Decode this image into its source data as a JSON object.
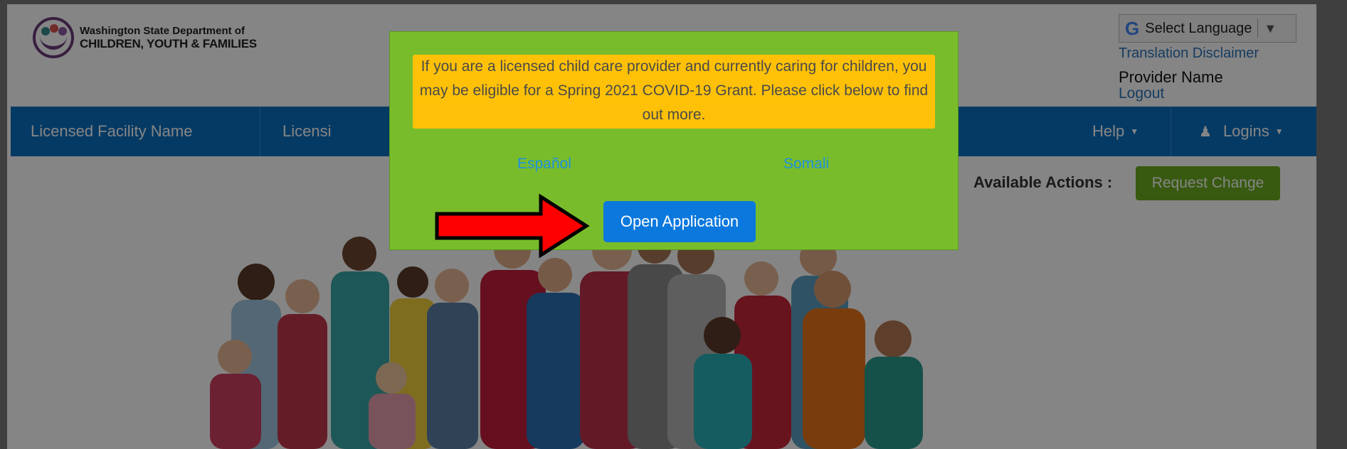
{
  "header": {
    "logo_line1": "Washington State Department of",
    "logo_line2": "CHILDREN, YOUTH & FAMILIES",
    "language_select": "Select Language",
    "translation_disclaimer": "Translation Disclaimer",
    "provider_name": "Provider Name",
    "logout": "Logout"
  },
  "nav": {
    "facility": "Licensed Facility Name",
    "licensing": "Licensi",
    "help": "Help",
    "logins": "Logins"
  },
  "actions": {
    "label": "Available Actions :",
    "request_change": "Request Change"
  },
  "modal": {
    "notice": "If you are a licensed child care provider and currently caring for children, you may be eligible for a Spring 2021 COVID-19 Grant. Please click below to find out more.",
    "lang_es": "Español",
    "lang_so": "Somali",
    "open_application": "Open Application"
  },
  "colors": {
    "nav": "#0b6fc0",
    "modal": "#79bc2b",
    "notice": "#ffc107",
    "primary_button": "#0b78dd",
    "request_button": "#6bac1f",
    "arrow": "#ff0000"
  },
  "icons": [
    "google-icon",
    "user-icon",
    "caret-down-icon",
    "red-arrow-icon"
  ]
}
